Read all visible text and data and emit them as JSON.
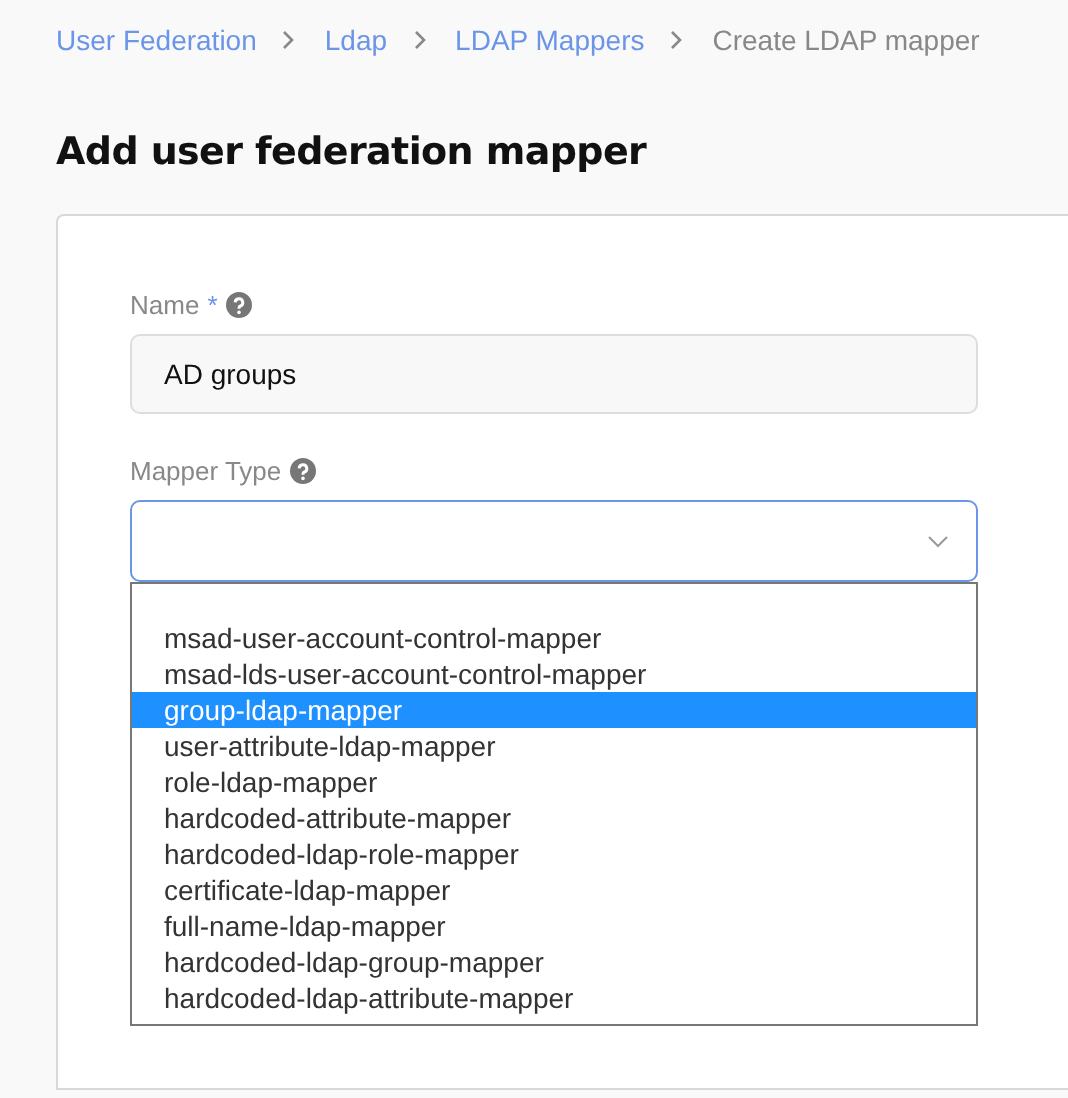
{
  "breadcrumb": [
    {
      "label": "User Federation",
      "link": true
    },
    {
      "label": "Ldap",
      "link": true
    },
    {
      "label": "LDAP Mappers",
      "link": true
    },
    {
      "label": "Create LDAP mapper",
      "link": false
    }
  ],
  "title": "Add user federation mapper",
  "form": {
    "name": {
      "label": "Name",
      "required_mark": "*",
      "value": "AD groups"
    },
    "mapper_type": {
      "label": "Mapper Type",
      "expanded": true,
      "options": [
        {
          "label": "msad-user-account-control-mapper",
          "selected": false
        },
        {
          "label": "msad-lds-user-account-control-mapper",
          "selected": false
        },
        {
          "label": "group-ldap-mapper",
          "selected": true
        },
        {
          "label": "user-attribute-ldap-mapper",
          "selected": false
        },
        {
          "label": "role-ldap-mapper",
          "selected": false
        },
        {
          "label": "hardcoded-attribute-mapper",
          "selected": false
        },
        {
          "label": "hardcoded-ldap-role-mapper",
          "selected": false
        },
        {
          "label": "certificate-ldap-mapper",
          "selected": false
        },
        {
          "label": "full-name-ldap-mapper",
          "selected": false
        },
        {
          "label": "hardcoded-ldap-group-mapper",
          "selected": false
        },
        {
          "label": "hardcoded-ldap-attribute-mapper",
          "selected": false
        }
      ]
    }
  }
}
